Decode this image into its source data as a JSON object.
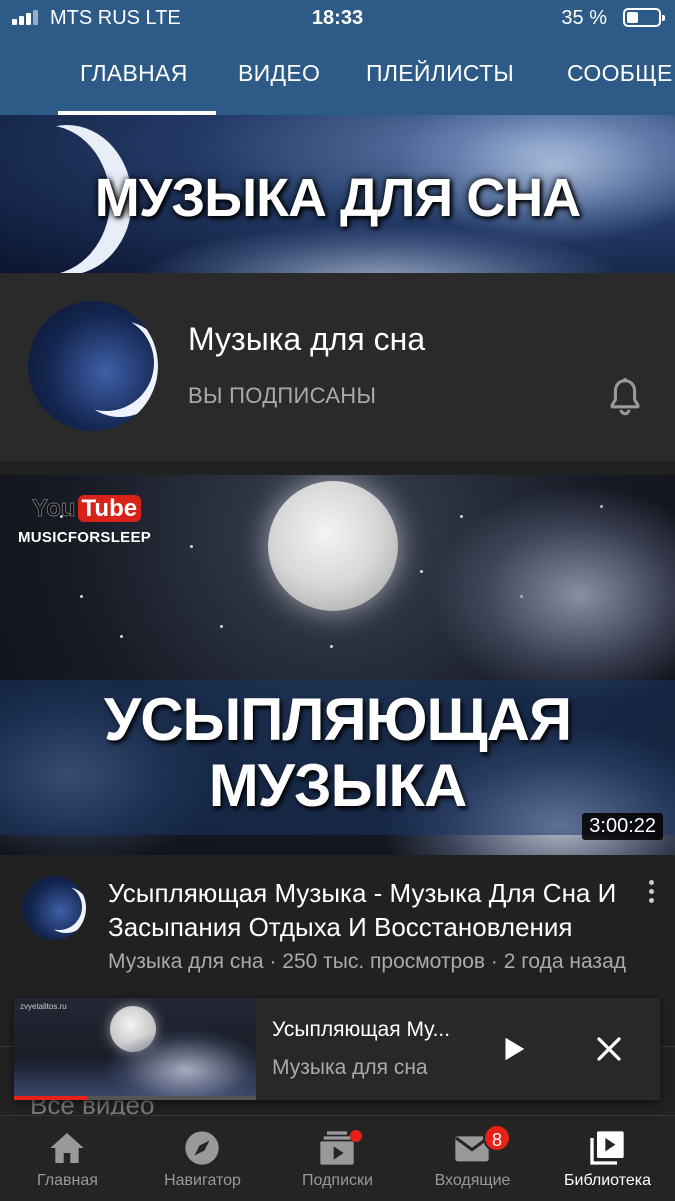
{
  "status_bar": {
    "carrier": "MTS RUS  LTE",
    "time": "18:33",
    "battery": "35 %",
    "battery_level": 0.35
  },
  "tabs": [
    {
      "label": "ГЛАВНАЯ",
      "active": true
    },
    {
      "label": "ВИДЕО",
      "active": false
    },
    {
      "label": "ПЛЕЙЛИСТЫ",
      "active": false
    },
    {
      "label": "СООБЩЕ",
      "active": false
    }
  ],
  "banner": {
    "title": "МУЗЫКА ДЛЯ СНА"
  },
  "channel": {
    "name": "Музыка для сна",
    "subscribed_label": "ВЫ ПОДПИСАНЫ",
    "bell_icon": "bell-icon"
  },
  "featured_video": {
    "thumbnail_title": "УСЫПЛЯЮЩАЯ МУЗЫКА",
    "logo_you": "You",
    "logo_tube": "Tube",
    "logo_channel": "MUSICFORSLEEP",
    "duration": "3:00:22",
    "title": "Усыпляющая Музыка - Музыка Для Сна И Засыпания Отдыха И Восстановления",
    "meta": "Музыка для сна · 250 тыс. просмотров · 2 года назад"
  },
  "section_title": "Все видео",
  "mini_player": {
    "watermark": "zvyetalitos.ru",
    "title": "Усыпляющая Му...",
    "channel": "Музыка для сна",
    "progress": 0.3
  },
  "bottom_nav": [
    {
      "label": "Главная",
      "icon": "home-icon"
    },
    {
      "label": "Навигатор",
      "icon": "compass-icon"
    },
    {
      "label": "Подписки",
      "icon": "subscriptions-icon",
      "dot": true
    },
    {
      "label": "Входящие",
      "icon": "inbox-icon",
      "badge": "8"
    },
    {
      "label": "Библиотека",
      "icon": "library-icon",
      "active": true
    }
  ],
  "colors": {
    "header": "#2d5a87",
    "background": "#212121",
    "accent": "#e62117"
  }
}
